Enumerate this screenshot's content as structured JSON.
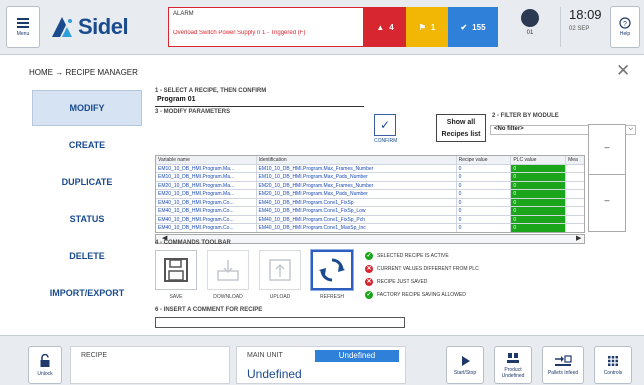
{
  "header": {
    "menu_label": "Menu",
    "logo_text": "Sidel",
    "alarm_title": "ALARM",
    "alarm_message": "Overload Switch Power Supply n 1 - Triggered (F)",
    "alarm_count": "4",
    "warning_count": "1",
    "info_count": "155",
    "station_number": "01",
    "time": "18:09",
    "date": "02 SEP",
    "help_label": "Help"
  },
  "breadcrumb": "HOME → RECIPE MANAGER",
  "sidebar": {
    "items": [
      {
        "label": "MODIFY"
      },
      {
        "label": "CREATE"
      },
      {
        "label": "DUPLICATE"
      },
      {
        "label": "STATUS"
      },
      {
        "label": "DELETE"
      },
      {
        "label": "IMPORT/EXPORT"
      }
    ]
  },
  "select": {
    "step1": "1 - SELECT A RECIPE, THEN CONFIRM",
    "recipe_value": "Program 01",
    "confirm_label": "CONFIRM",
    "show_all_label": "Show all Recipes list",
    "step2": "2 - FILTER BY MODULE",
    "filter_value": "<No filter>"
  },
  "params": {
    "step3": "3 - MODIFY PARAMETERS",
    "columns": [
      "Variable name",
      "Identification",
      "Recipe value",
      "PLC value",
      "Mea"
    ],
    "rows": [
      [
        "EM10_10_DB_HMI.Program.Ma...",
        "EM10_10_DB_HMI.Program.Max_Frames_Number",
        "0",
        "0",
        ""
      ],
      [
        "EM10_10_DB_HMI.Program.Ma...",
        "EM10_10_DB_HMI.Program.Max_Pads_Number",
        "0",
        "0",
        ""
      ],
      [
        "EM20_10_DB_HMI.Program.Ma...",
        "EM20_10_DB_HMI.Program.Max_Frames_Number",
        "0",
        "0",
        ""
      ],
      [
        "EM20_10_DB_HMI.Program.Ma...",
        "EM20_10_DB_HMI.Program.Max_Pads_Number",
        "0",
        "0",
        ""
      ],
      [
        "EM40_10_DB_HMI.Program.Co...",
        "EM40_10_DB_HMI.Program.Conv1_FixSp",
        "0",
        "0",
        ""
      ],
      [
        "EM40_10_DB_HMI.Program.Co...",
        "EM40_10_DB_HMI.Program.Conv1_FixSp_Low",
        "0",
        "0",
        ""
      ],
      [
        "EM40_10_DB_HMI.Program.Co...",
        "EM40_10_DB_HMI.Program.Conv1_FixSp_Pch",
        "0",
        "0",
        ""
      ],
      [
        "EM40_10_DB_HMI.Program.Co...",
        "EM40_10_DB_HMI.Program.Conv1_MaxSp_Inc",
        "0",
        "0",
        ""
      ]
    ]
  },
  "toolbar": {
    "step4": "4 - COMMANDS TOOLBAR",
    "save_label": "SAVE",
    "download_label": "DOWNLOAD",
    "upload_label": "UPLOAD",
    "refresh_label": "REFRESH",
    "messages": [
      {
        "text": "SELECTED RECIPE IS ACTIVE",
        "status": "ok",
        "glyph": "✓",
        "color": "#1aa51a"
      },
      {
        "text": "CURRENT VALUES DIFFERENT FROM PLC",
        "status": "error",
        "glyph": "✕",
        "color": "#d7262f"
      },
      {
        "text": "RECIPE JUST SAVED",
        "status": "error",
        "glyph": "✕",
        "color": "#d7262f"
      },
      {
        "text": "FACTORY RECIPE SAVING ALLOWED",
        "status": "ok",
        "glyph": "✓",
        "color": "#1aa51a"
      }
    ]
  },
  "comment": {
    "step6": "6 - INSERT A COMMENT FOR RECIPE",
    "value": ""
  },
  "footer": {
    "unlock_label": "Unlock",
    "recipe_label": "RECIPE",
    "main_unit_label": "MAIN UNIT",
    "main_unit_badge": "Undefined",
    "main_unit_value": "Undefined",
    "start_stop_label": "Start/Stop",
    "product_label": "Product Undefined",
    "pallets_label": "Pallets Infeed",
    "controls_label": "Controls"
  },
  "colors": {
    "brand_blue": "#1a4b8f",
    "alarm_red": "#d7262f",
    "warning_yellow": "#f2b705",
    "info_blue": "#2f80d8",
    "plc_green": "#1aa51a"
  }
}
